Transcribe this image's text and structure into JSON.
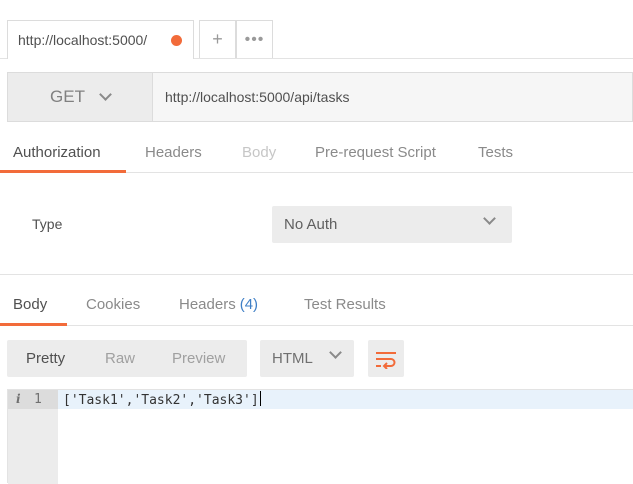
{
  "tabs": {
    "request_tab_label": "http://localhost:5000/",
    "add_tab": "+",
    "more_tab": "•••"
  },
  "request": {
    "method": "GET",
    "url": "http://localhost:5000/api/tasks"
  },
  "request_sections": {
    "authorization": "Authorization",
    "headers": "Headers",
    "body": "Body",
    "prerequest": "Pre-request Script",
    "tests": "Tests"
  },
  "auth": {
    "type_label": "Type",
    "type_value": "No Auth"
  },
  "response_sections": {
    "body": "Body",
    "cookies": "Cookies",
    "headers": "Headers",
    "headers_count": "(4)",
    "test_results": "Test Results"
  },
  "response_view": {
    "pretty": "Pretty",
    "raw": "Raw",
    "preview": "Preview",
    "language": "HTML"
  },
  "code": {
    "line_number": "1",
    "info_icon": "i",
    "content": "['Task1','Task2','Task3']"
  },
  "colors": {
    "accent": "#f26b3a",
    "headers_count": "#3f7fc6"
  },
  "icons": {
    "unsaved": "unsaved-dot-icon",
    "method_dropdown": "chevron-down-icon",
    "auth_dropdown": "chevron-down-icon",
    "language_dropdown": "chevron-down-icon",
    "wrap": "wrap-lines-icon",
    "info": "info-icon"
  }
}
